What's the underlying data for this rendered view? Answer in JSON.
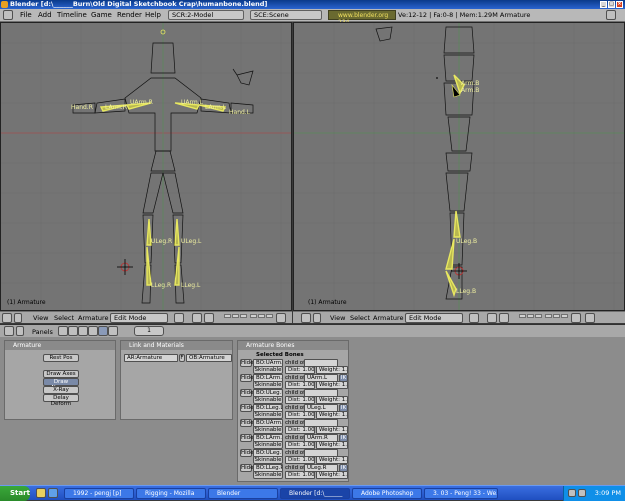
{
  "window": {
    "title": "Blender [d:\\______Burn\\Old Digital Sketchbook Crap\\humanbone.blend]"
  },
  "menubar": {
    "items": [
      "File",
      "Add",
      "Timeline",
      "Game",
      "Render",
      "Help"
    ],
    "screen_select": "SCR:2-Model",
    "scene_select": "SCE:Scene",
    "url": "www.blender.org 234",
    "stats": "Ve:12-12 | Fa:0-8 | Mem:1.29M Armature"
  },
  "viewport_left": {
    "status": "(1) Armature",
    "labels": [
      "UArm.R",
      "LArm.R",
      "Hand.R",
      "UArm.L",
      "LArm.L",
      "Hand.L",
      "ULeg.R",
      "ULeg.L",
      "LLeg.R",
      "LLeg.L"
    ],
    "header": {
      "view": "View",
      "select": "Select",
      "armature": "Armature",
      "mode": "Edit Mode"
    }
  },
  "viewport_right": {
    "status": "(1) Armature",
    "labels": [
      "Arm.B",
      "Arm.B",
      "ULeg.B",
      "LLeg.B"
    ],
    "header": {
      "view": "View",
      "select": "Select",
      "armature": "Armature",
      "mode": "Edit Mode"
    }
  },
  "buttons_header": {
    "panels": "Panels",
    "frame": "1"
  },
  "armature_panel": {
    "title": "Armature",
    "rest_pos": "Rest Pos",
    "draw_axes": "Draw Axes",
    "draw_names": "Draw Names",
    "xray": "X-Ray",
    "delay_deform": "Delay Deform"
  },
  "link_panel": {
    "title": "Link and Materials",
    "ar_name": "AR:Armature",
    "ob_name": "OB:Armature",
    "f_label": "F"
  },
  "bones_panel": {
    "title": "Armature Bones",
    "subtitle": "Selected Bones",
    "bones": [
      {
        "hide": "Hide",
        "name": "BO:UArm.L",
        "child_of": "child of",
        "parent": "",
        "skin": "Skinnable",
        "dist": "Dist: 1.00",
        "weight": "Weight: 1.00",
        "ik": ""
      },
      {
        "hide": "Hide",
        "name": "BO:LArm.L",
        "child_of": "child of",
        "parent": "UArm.L",
        "skin": "Skinnable",
        "dist": "Dist: 1.00",
        "weight": "Weight: 1.00",
        "ik": "IK"
      },
      {
        "hide": "Hide",
        "name": "BO:ULeg.L",
        "child_of": "child of",
        "parent": "",
        "skin": "Skinnable",
        "dist": "Dist: 1.00",
        "weight": "Weight: 1.00",
        "ik": ""
      },
      {
        "hide": "Hide",
        "name": "BO:LLeg.L",
        "child_of": "child of",
        "parent": "ULeg.L",
        "skin": "Skinnable",
        "dist": "Dist: 1.00",
        "weight": "Weight: 1.00",
        "ik": "IK"
      },
      {
        "hide": "Hide",
        "name": "BO:UArm.R",
        "child_of": "child of",
        "parent": "",
        "skin": "Skinnable",
        "dist": "Dist: 1.00",
        "weight": "Weight: 1.00",
        "ik": ""
      },
      {
        "hide": "Hide",
        "name": "BO:LArm.R",
        "child_of": "child of",
        "parent": "UArm.R",
        "skin": "Skinnable",
        "dist": "Dist: 1.00",
        "weight": "Weight: 1.00",
        "ik": "IK"
      },
      {
        "hide": "Hide",
        "name": "BO:ULeg.R",
        "child_of": "child of",
        "parent": "",
        "skin": "Skinnable",
        "dist": "Dist: 1.00",
        "weight": "Weight: 1.00",
        "ik": ""
      },
      {
        "hide": "Hide",
        "name": "BO:LLeg.R",
        "child_of": "child of",
        "parent": "ULeg.R",
        "skin": "Skinnable",
        "dist": "Dist: 1.00",
        "weight": "Weight: 1.00",
        "ik": "IK"
      }
    ]
  },
  "taskbar": {
    "start": "Start",
    "tasks": [
      "1992 - pengj [p]",
      "Rigging - Mozilla",
      "Blender",
      "Blender [d:\\______",
      "Adobe Photoshop",
      "3. 03 - Peng! 33 - We..."
    ],
    "clock": "3:09 PM"
  },
  "colors": {
    "bone": "#e8e860",
    "viewport_bg": "#747474",
    "panel_bg": "#a6a6a6"
  }
}
